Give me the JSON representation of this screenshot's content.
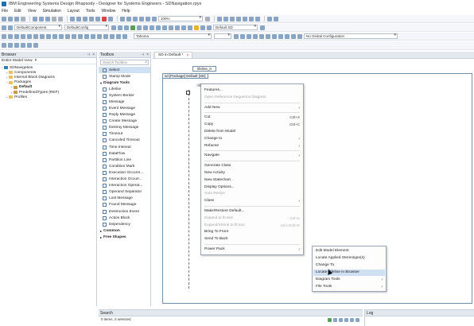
{
  "window": {
    "title": "IBM Engineering Systems Design Rhapsody - Designer for Systems Engineers - SDNavigation.rpyx"
  },
  "menu": {
    "items": [
      "File",
      "Edit",
      "View",
      "Simulation",
      "Layout",
      "Tools",
      "Window",
      "Help"
    ]
  },
  "toolbar2": {
    "zoom_value": "100%"
  },
  "toolbar3": {
    "model_dropdown": "DefaultComponent",
    "config_dropdown": "DefaultConfig",
    "diagram_dropdown": "Default.SD",
    "search_placeholder": "No Global Configuration"
  },
  "toolbar4": {
    "font_dropdown": "Tahoma"
  },
  "browser": {
    "title": "Browser",
    "filter": "Entire Model View",
    "tree": [
      {
        "label": "SDNavigation",
        "level": 0,
        "icon": "project-icon",
        "toggle": "−"
      },
      {
        "label": "Components",
        "level": 1,
        "icon": "folder-icon",
        "toggle": "+"
      },
      {
        "label": "Internal Block Diagrams",
        "level": 1,
        "icon": "folder-icon",
        "toggle": "+"
      },
      {
        "label": "Packages",
        "level": 1,
        "icon": "folder-icon",
        "toggle": "−"
      },
      {
        "label": "Default",
        "level": 2,
        "icon": "package-icon",
        "toggle": "+",
        "bold": true
      },
      {
        "label": "PredefinedTypes (REF)",
        "level": 2,
        "icon": "package-icon",
        "toggle": "+"
      },
      {
        "label": "Profiles",
        "level": 1,
        "icon": "folder-icon",
        "toggle": "+"
      }
    ]
  },
  "toolbox": {
    "title": "Toolbox",
    "search_placeholder": "Search Toolbox",
    "top_items": [
      "Select",
      "Stamp Mode"
    ],
    "section_diagram_tools": "Diagram Tools",
    "diagram_tools": [
      "Lifeline",
      "System Border",
      "Message",
      "Event Message",
      "Reply Message",
      "Create Message",
      "Destroy Message",
      "Timeout",
      "Canceled Timeout",
      "Time Interval",
      "DataFlow",
      "Partition Line",
      "Condition Mark",
      "Execution Occurre...",
      "Interaction Occurr...",
      "Interaction Operat...",
      "Operand Separator",
      "Lost Message",
      "Found Message",
      "Destruction Event",
      "Action Block",
      "Dependency"
    ],
    "section_common": "Common",
    "section_free_shapes": "Free Shapes"
  },
  "editor": {
    "tab_label": "SD in Default *",
    "lifeline_top": "lifeline_0",
    "frame_label": "sd [Package] Default [SD]",
    "lifeline_head": ":lifeline_0"
  },
  "context_menu": {
    "items": [
      {
        "label": "Features...",
        "shortcut": "",
        "submenu": false,
        "disabled": false
      },
      {
        "label": "Open Reference Sequence Diagram",
        "shortcut": "",
        "submenu": false,
        "disabled": true
      },
      {
        "label": "Add New",
        "shortcut": "",
        "submenu": true,
        "disabled": false,
        "sep_before": true
      },
      {
        "label": "Cut",
        "shortcut": "Ctrl+X",
        "submenu": false,
        "disabled": false,
        "sep_before": true
      },
      {
        "label": "Copy",
        "shortcut": "Ctrl+C",
        "submenu": false,
        "disabled": false
      },
      {
        "label": "Delete from Model",
        "shortcut": "",
        "submenu": false,
        "disabled": false
      },
      {
        "label": "Change to",
        "shortcut": "",
        "submenu": true,
        "disabled": false
      },
      {
        "label": "Refactor",
        "shortcut": "",
        "submenu": true,
        "disabled": false
      },
      {
        "label": "Navigate",
        "shortcut": "",
        "submenu": true,
        "disabled": false,
        "sep_before": true
      },
      {
        "label": "Generate Class",
        "shortcut": "",
        "submenu": false,
        "disabled": false,
        "sep_before": true
      },
      {
        "label": "New Activity",
        "shortcut": "",
        "submenu": false,
        "disabled": false
      },
      {
        "label": "New Statechart",
        "shortcut": "",
        "submenu": false,
        "disabled": false
      },
      {
        "label": "Display Options...",
        "shortcut": "",
        "submenu": false,
        "disabled": false
      },
      {
        "label": "Auto Resize",
        "shortcut": "",
        "submenu": false,
        "disabled": true
      },
      {
        "label": "Class",
        "shortcut": "",
        "submenu": true,
        "disabled": false
      },
      {
        "label": "Make/Restore Default...",
        "shortcut": "",
        "submenu": false,
        "disabled": false,
        "sep_before": true
      },
      {
        "label": "Expand to fit text",
        "shortcut": "Ctrl+E",
        "submenu": false,
        "disabled": true
      },
      {
        "label": "Expand/Shrink to fit text",
        "shortcut": "Ctrl+Shift+E",
        "submenu": false,
        "disabled": true
      },
      {
        "label": "Bring To Front",
        "shortcut": "",
        "submenu": false,
        "disabled": false
      },
      {
        "label": "Send To Back",
        "shortcut": "",
        "submenu": false,
        "disabled": false
      },
      {
        "label": "Power Pack",
        "shortcut": "",
        "submenu": true,
        "disabled": false,
        "sep_before": true
      }
    ]
  },
  "submenu": {
    "items": [
      {
        "label": "Edit Model Element",
        "submenu": false
      },
      {
        "label": "Locate Applied Stereotype(s)",
        "submenu": false
      },
      {
        "label": "Change To",
        "submenu": false
      },
      {
        "label": "Locate Lifeline in Browser",
        "submenu": false,
        "highlighted": true
      },
      {
        "label": "Diagram Tools",
        "submenu": true
      },
      {
        "label": "File Tools",
        "submenu": true
      }
    ]
  },
  "search_panel": {
    "title": "Search",
    "status": "0 items, 0 selected"
  },
  "log_panel": {
    "title": "Log"
  }
}
